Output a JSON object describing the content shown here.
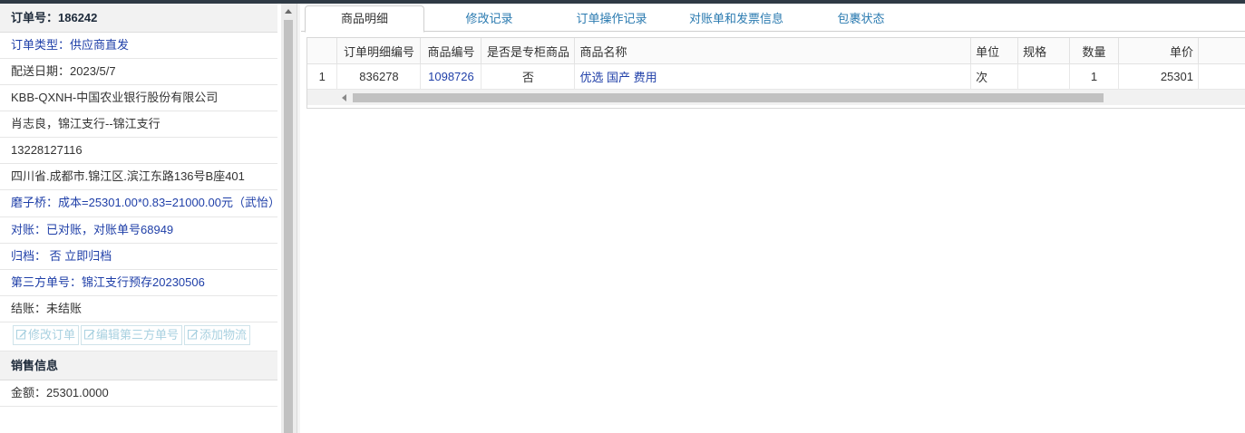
{
  "order": {
    "number_label": "订单号：186242",
    "type": "订单类型：供应商直发",
    "delivery_date": "配送日期：2023/5/7",
    "customer": "KBB-QXNH-中国农业银行股份有限公司",
    "contact": "肖志良，锦江支行--锦江支行",
    "phone": "13228127116",
    "address": "四川省.成都市.锦江区.滨江东路136号B座401",
    "note": "磨子桥：成本=25301.00*0.83=21000.00元（武怡）",
    "reconcile": "对账：已对账，对账单号68949",
    "archive": "归档： 否 立即归档",
    "third_party": "第三方单号：锦江支行预存20230506",
    "settlement": "结账：未结账"
  },
  "buttons": {
    "edit_order": "修改订单",
    "edit_third_party": "编辑第三方单号",
    "add_logistics": "添加物流"
  },
  "sales": {
    "title": "销售信息",
    "amount": "金额：25301.0000"
  },
  "tabs": [
    "商品明细",
    "修改记录",
    "订单操作记录",
    "对账单和发票信息",
    "包裹状态"
  ],
  "grid": {
    "columns": [
      "订单明细编号",
      "商品编号",
      "是否是专柜商品",
      "商品名称",
      "单位",
      "规格",
      "数量",
      "单价"
    ],
    "rows": [
      {
        "index": "1",
        "detail_id": "836278",
        "product_id": "1098726",
        "is_counter": "否",
        "name": "优选 国产 费用",
        "unit": "次",
        "spec": "",
        "qty": "1",
        "price": "25301"
      }
    ]
  },
  "colors": {
    "link_blue": "#1f3fa8",
    "tab_blue": "#2a7ab0",
    "disabled_button": "#a9d1e0",
    "topbar": "#2f3a45"
  }
}
